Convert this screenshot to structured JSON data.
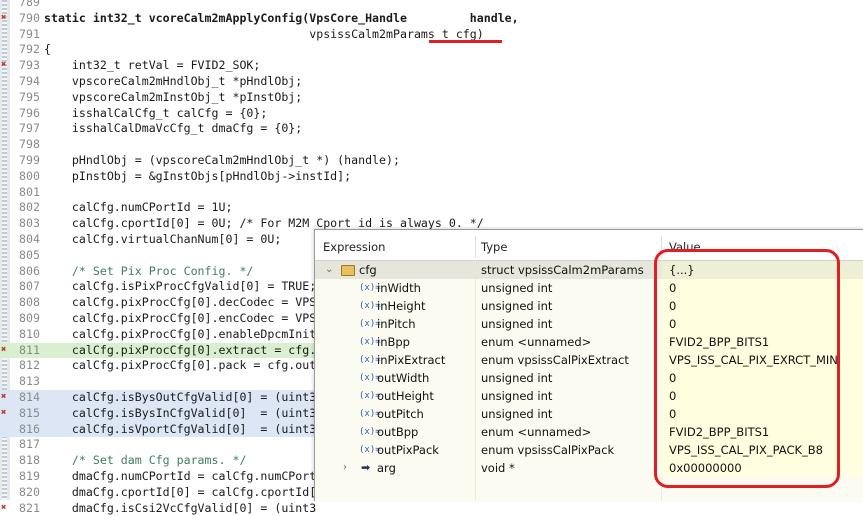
{
  "editor": {
    "lines": [
      {
        "n": "789",
        "text": ""
      },
      {
        "n": "790",
        "text": "static int32_t vcoreCalm2mApplyConfig(VpsCore_Handle         handle,"
      },
      {
        "n": "791",
        "text": "                                      vpsissCalm2mParams_t cfg)"
      },
      {
        "n": "792",
        "text": "{"
      },
      {
        "n": "793",
        "text": "    int32_t retVal = FVID2_SOK;"
      },
      {
        "n": "794",
        "text": "    vpscoreCalm2mHndlObj_t *pHndlObj;"
      },
      {
        "n": "795",
        "text": "    vpscoreCalm2mInstObj_t *pInstObj;"
      },
      {
        "n": "796",
        "text": "    isshalCalCfg_t calCfg = {0};"
      },
      {
        "n": "797",
        "text": "    isshalCalDmaVcCfg_t dmaCfg = {0};"
      },
      {
        "n": "798",
        "text": ""
      },
      {
        "n": "799",
        "text": "    pHndlObj = (vpscoreCalm2mHndlObj_t *) (handle);"
      },
      {
        "n": "800",
        "text": "    pInstObj = &gInstObjs[pHndlObj->instId];"
      },
      {
        "n": "801",
        "text": ""
      },
      {
        "n": "802",
        "text": "    calCfg.numCPortId = 1U;"
      },
      {
        "n": "803",
        "text": "    calCfg.cportId[0] = 0U; /* For M2M Cport id is always 0. */"
      },
      {
        "n": "804",
        "text": "    calCfg.virtualChanNum[0] = 0U;"
      },
      {
        "n": "805",
        "text": ""
      },
      {
        "n": "806",
        "text": "    /* Set Pix Proc Config. */"
      },
      {
        "n": "807",
        "text": "    calCfg.isPixProcCfgValid[0] = TRUE;"
      },
      {
        "n": "808",
        "text": "    calCfg.pixProcCfg[0].decCodec = VPS"
      },
      {
        "n": "809",
        "text": "    calCfg.pixProcCfg[0].encCodec = VPS"
      },
      {
        "n": "810",
        "text": "    calCfg.pixProcCfg[0].enableDpcmInit"
      },
      {
        "n": "811",
        "text": "    calCfg.pixProcCfg[0].extract = cfg."
      },
      {
        "n": "812",
        "text": "    calCfg.pixProcCfg[0].pack = cfg.out"
      },
      {
        "n": "813",
        "text": ""
      },
      {
        "n": "814",
        "text": "    calCfg.isBysOutCfgValid[0] = (uint3"
      },
      {
        "n": "815",
        "text": "    calCfg.isBysInCfgValid[0]  = (uint3"
      },
      {
        "n": "816",
        "text": "    calCfg.isVportCfgValid[0]  = (uint3"
      },
      {
        "n": "817",
        "text": ""
      },
      {
        "n": "818",
        "text": "    /* Set dam Cfg params. */"
      },
      {
        "n": "819",
        "text": "    dmaCfg.numCPortId = calCfg.numCPort"
      },
      {
        "n": "820",
        "text": "    dmaCfg.cportId[0] = calCfg.cportId["
      },
      {
        "n": "821",
        "text": "    dmaCfg.isCsi2VcCfgValid[0] = (uint3"
      }
    ]
  },
  "expressions": {
    "headers": {
      "expression": "Expression",
      "type": "Type",
      "value": "Value"
    },
    "root": {
      "name": "cfg",
      "type": "struct vpsissCalm2mParams",
      "value": "{...}"
    },
    "rows": [
      {
        "name": "inWidth",
        "type": "unsigned int",
        "value": "0"
      },
      {
        "name": "inHeight",
        "type": "unsigned int",
        "value": "0"
      },
      {
        "name": "inPitch",
        "type": "unsigned int",
        "value": "0"
      },
      {
        "name": "inBpp",
        "type": "enum <unnamed>",
        "value": "FVID2_BPP_BITS1"
      },
      {
        "name": "inPixExtract",
        "type": "enum vpsissCalPixExtract",
        "value": "VPS_ISS_CAL_PIX_EXRCT_MIN"
      },
      {
        "name": "outWidth",
        "type": "unsigned int",
        "value": "0"
      },
      {
        "name": "outHeight",
        "type": "unsigned int",
        "value": "0"
      },
      {
        "name": "outPitch",
        "type": "unsigned int",
        "value": "0"
      },
      {
        "name": "outBpp",
        "type": "enum <unnamed>",
        "value": "FVID2_BPP_BITS1"
      },
      {
        "name": "outPixPack",
        "type": "enum vpsissCalPixPack",
        "value": "VPS_ISS_CAL_PIX_PACK_B8"
      }
    ],
    "arg": {
      "name": "arg",
      "type": "void *",
      "value": "0x00000000"
    },
    "var_icon": "(x)=",
    "icons": {
      "root": "folder-icon",
      "variable": "variable-icon",
      "pointer": "pointer-arrow-icon"
    }
  },
  "colors": {
    "annotation": "#e02020",
    "keyword": "#7f0055",
    "comment": "#3f7f5f",
    "highlight": "#d8f0d0"
  }
}
